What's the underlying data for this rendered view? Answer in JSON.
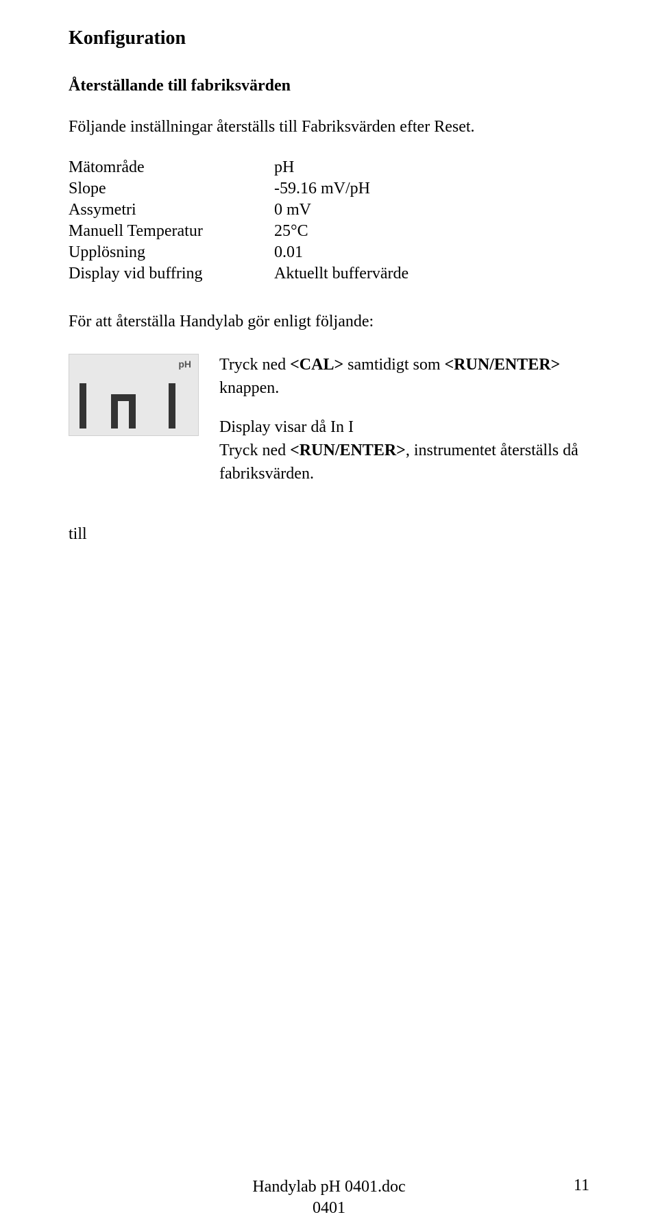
{
  "heading1": "Konfiguration",
  "heading2": "Återställande till fabriksvärden",
  "intro": "Följande inställningar återställs till Fabriksvärden efter Reset.",
  "settings": {
    "rows": [
      {
        "label": "Mätområde",
        "value": "pH"
      },
      {
        "label": "Slope",
        "value": "-59.16 mV/pH"
      },
      {
        "label": "Assymetri",
        "value": "0 mV"
      },
      {
        "label": "Manuell Temperatur",
        "value": "25°C"
      },
      {
        "label": "Upplösning",
        "value": "0.01"
      },
      {
        "label": "Display vid buffring",
        "value": "Aktuellt buffervärde"
      }
    ]
  },
  "restore_line": "För att återställa Handylab gör enligt följande:",
  "lcd": {
    "badge": "pH",
    "glyphs": "In I"
  },
  "instructions": {
    "line1_pre": "Tryck ned ",
    "line1_cal": "<CAL>",
    "line1_mid": " samtidigt som ",
    "line1_run": "<RUN/ENTER>",
    "line2": "knappen.",
    "line3": "Display visar då In I",
    "line4_pre": "Tryck ned ",
    "line4_run": "<RUN/ENTER>",
    "line4_post": ", instrumentet återställs då",
    "till": "till",
    "line5": " fabriksvärden."
  },
  "footer": {
    "center1": "Handylab pH  0401.doc",
    "center2": "0401",
    "page": "11"
  }
}
